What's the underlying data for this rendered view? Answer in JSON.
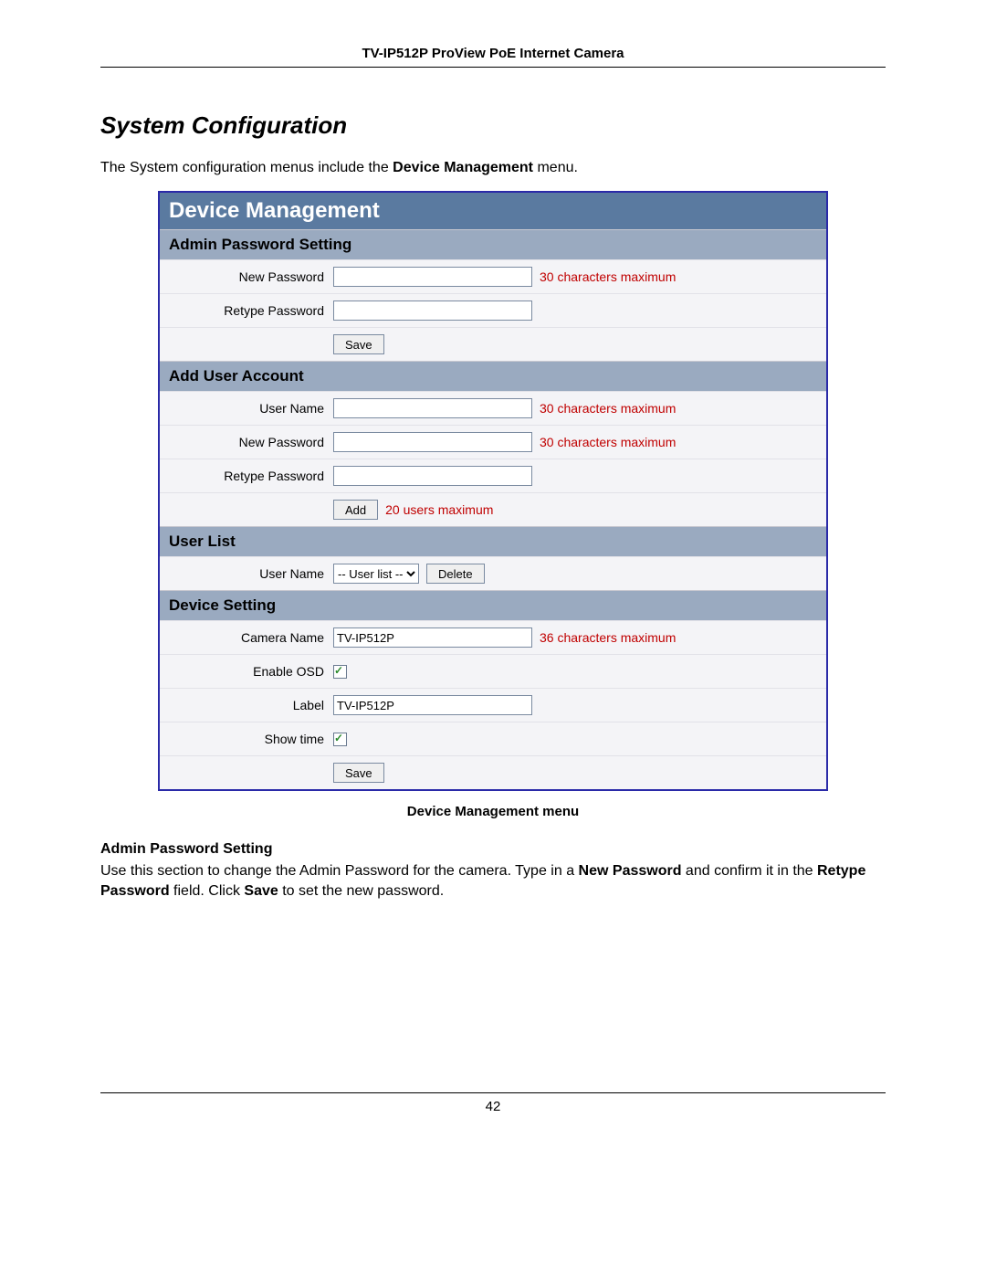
{
  "doc": {
    "header": "TV-IP512P ProView PoE Internet Camera",
    "page_number": "42"
  },
  "section": {
    "title": "System Configuration",
    "intro_pre": "The System configuration menus include the ",
    "intro_bold": "Device Management",
    "intro_post": " menu."
  },
  "panel": {
    "title": "Device Management",
    "admin_pw": {
      "header": "Admin Password Setting",
      "new_pw_label": "New Password",
      "new_pw_hint": "30 characters maximum",
      "retype_label": "Retype Password",
      "save_btn": "Save"
    },
    "add_user": {
      "header": "Add User Account",
      "user_name_label": "User Name",
      "user_name_hint": "30 characters maximum",
      "new_pw_label": "New Password",
      "new_pw_hint": "30 characters maximum",
      "retype_label": "Retype Password",
      "add_btn": "Add",
      "add_hint": "20 users maximum"
    },
    "user_list": {
      "header": "User List",
      "user_name_label": "User Name",
      "select_placeholder": "-- User list --",
      "delete_btn": "Delete"
    },
    "device_setting": {
      "header": "Device Setting",
      "camera_name_label": "Camera Name",
      "camera_name_value": "TV-IP512P",
      "camera_name_hint": "36 characters maximum",
      "enable_osd_label": "Enable OSD",
      "enable_osd_checked": true,
      "label_label": "Label",
      "label_value": "TV-IP512P",
      "show_time_label": "Show time",
      "show_time_checked": true,
      "save_btn": "Save"
    }
  },
  "caption": "Device Management menu",
  "explain": {
    "heading": "Admin Password Setting",
    "t1": "Use this section to change the Admin Password for the camera. Type in a ",
    "b1": "New Password",
    "t2": " and confirm it in the ",
    "b2": "Retype Password",
    "t3": " field. Click ",
    "b3": "Save",
    "t4": " to set the new password."
  }
}
